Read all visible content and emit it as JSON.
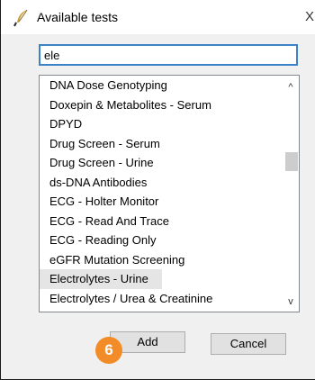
{
  "window": {
    "title": "Available tests",
    "close_glyph": "X",
    "app_icon": "feather-icon"
  },
  "search": {
    "value": "ele"
  },
  "list": {
    "items": [
      {
        "label": "DNA Dose Genotyping"
      },
      {
        "label": "Doxepin & Metabolites - Serum"
      },
      {
        "label": "DPYD"
      },
      {
        "label": "Drug Screen - Serum"
      },
      {
        "label": "Drug Screen - Urine"
      },
      {
        "label": "ds-DNA Antibodies"
      },
      {
        "label": "ECG - Holter Monitor"
      },
      {
        "label": "ECG - Read And Trace"
      },
      {
        "label": "ECG - Reading Only"
      },
      {
        "label": "eGFR Mutation Screening"
      },
      {
        "label": "Electrolytes - Urine",
        "selected": true
      },
      {
        "label": "Electrolytes / Urea & Creatinine"
      }
    ],
    "scroll_up_glyph": "^",
    "scroll_down_glyph": "v"
  },
  "buttons": {
    "add_label": "Add",
    "cancel_label": "Cancel"
  },
  "annotation": {
    "step": "6",
    "color": "#f28c28"
  },
  "colors": {
    "input_border": "#3c82c8",
    "selected_row": "#e5e5e5"
  }
}
